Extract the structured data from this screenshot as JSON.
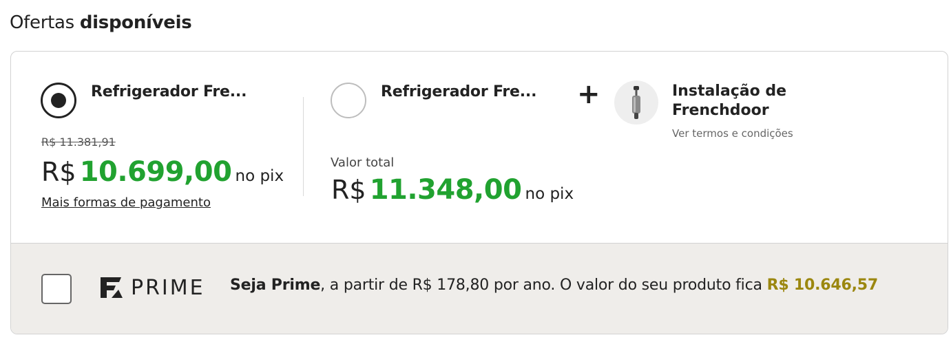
{
  "heading": {
    "regular": "Ofertas",
    "bold": "disponíveis"
  },
  "offer_single": {
    "product_name": "Refrigerador Fre...",
    "old_price": "R$ 11.381,91",
    "currency": "R$",
    "price": "10.699,00",
    "price_suffix": "no pix",
    "more_payment": "Mais formas de pagamento",
    "selected": true
  },
  "offer_combo": {
    "product_name": "Refrigerador Fre...",
    "plus": "+",
    "service_name": "Instalação de Frenchdoor",
    "terms_link": "Ver termos e condições",
    "total_label": "Valor total",
    "currency": "R$",
    "price": "11.348,00",
    "price_suffix": "no pix",
    "selected": false
  },
  "prime": {
    "logo_word": "PRIME",
    "bold_lead": "Seja Prime",
    "text": ", a partir de R$ 178,80 por ano. O valor do seu produto fica ",
    "highlight_price": "R$ 10.646,57",
    "checked": false
  },
  "colors": {
    "price_green": "#21a230",
    "prime_gold": "#9b8710",
    "prime_bg": "#efedea"
  }
}
